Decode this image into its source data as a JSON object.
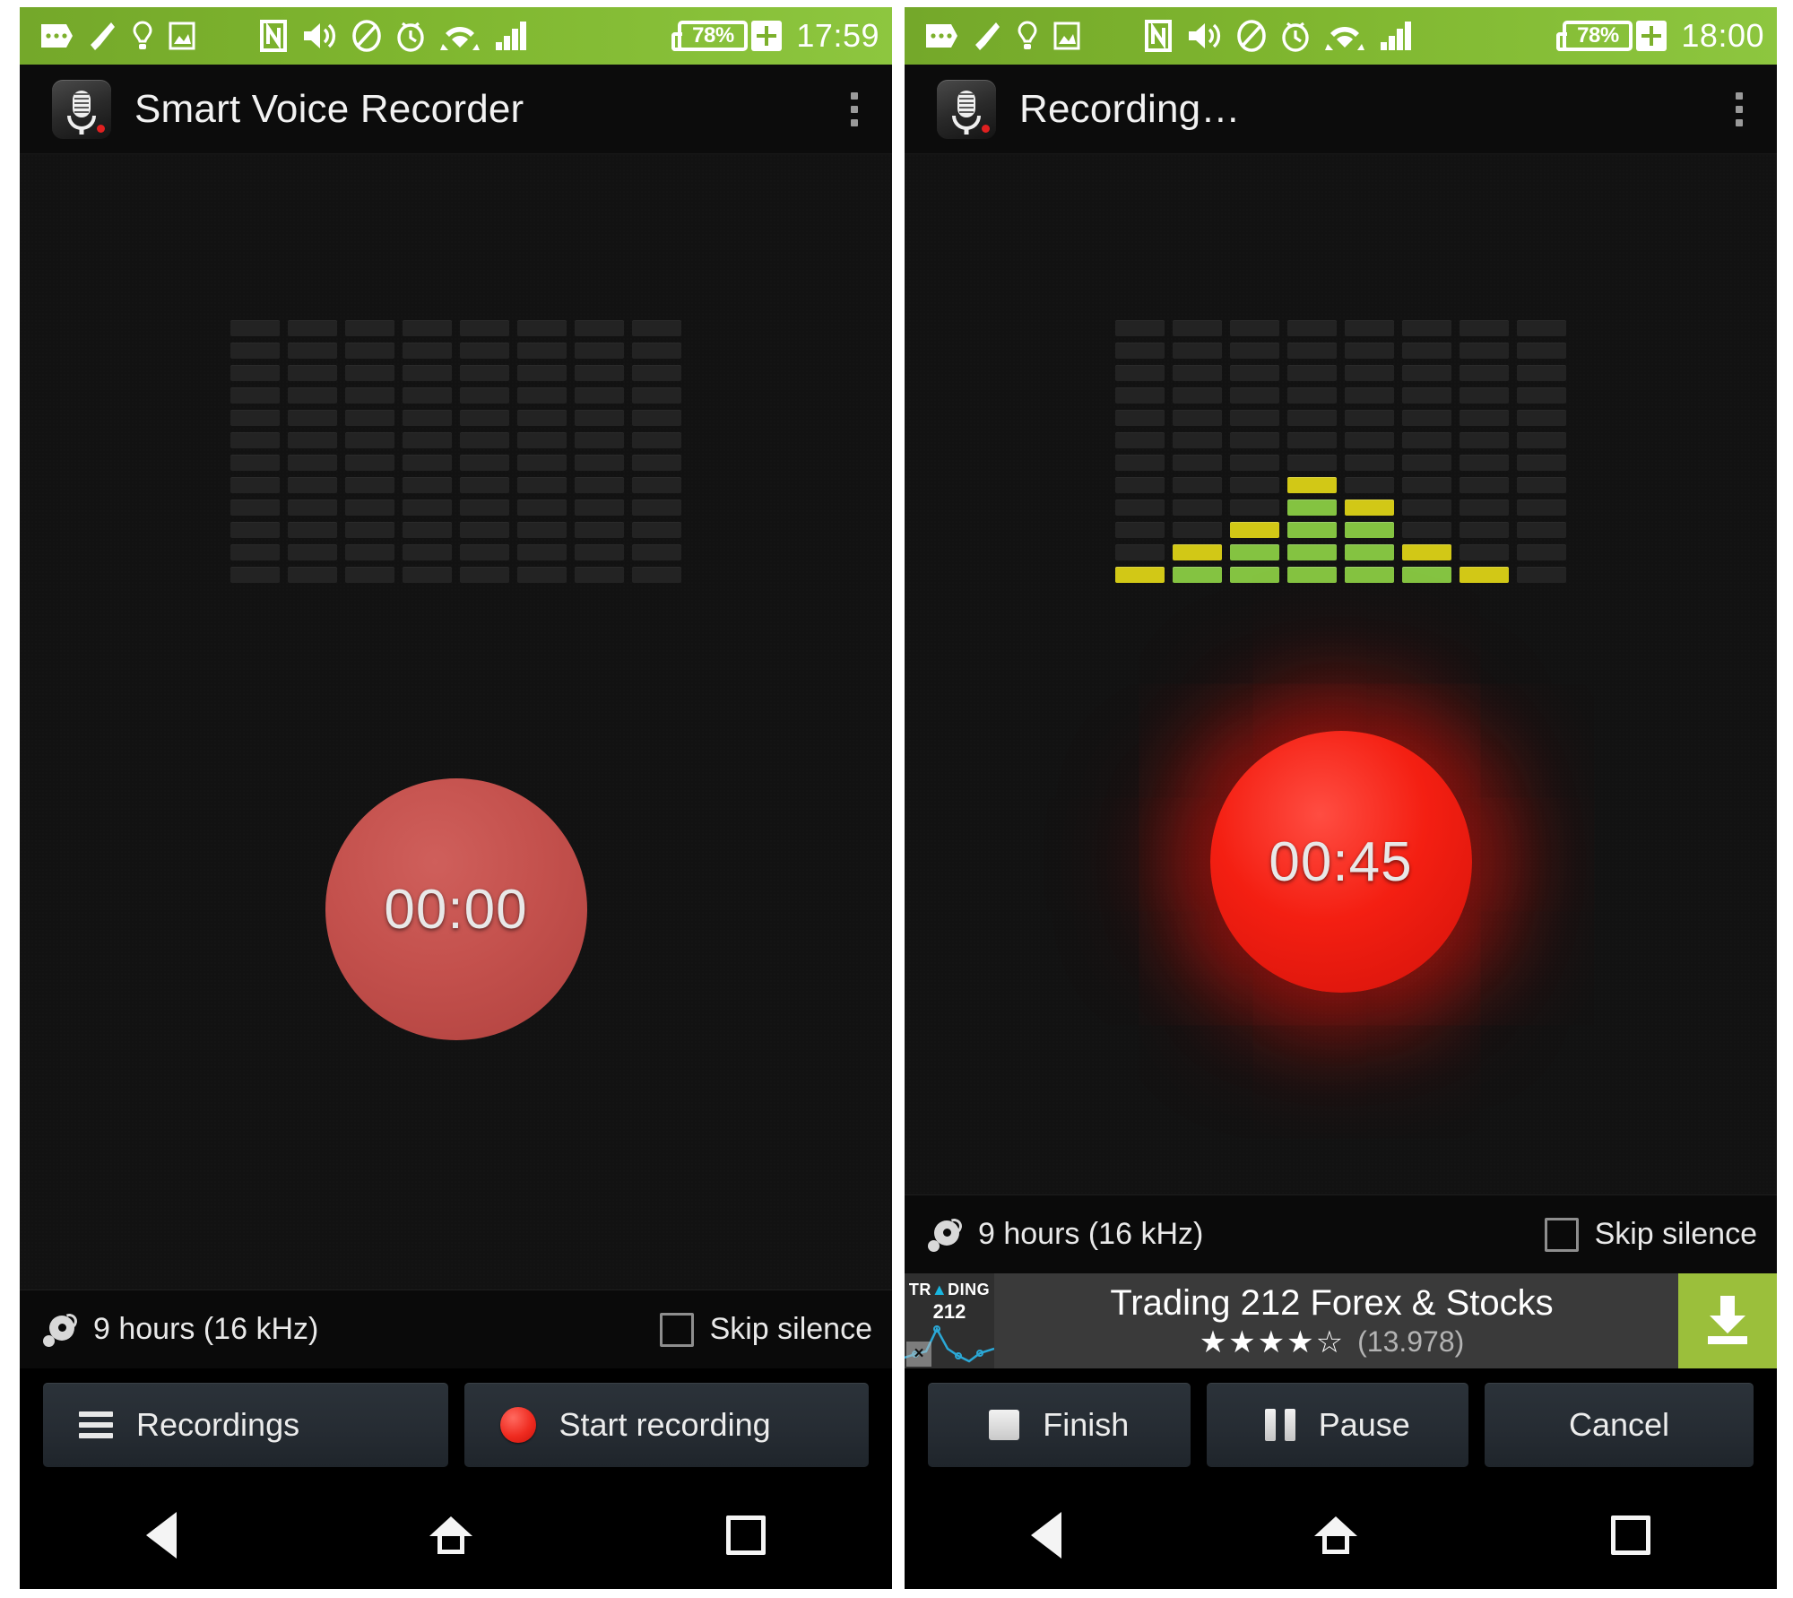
{
  "panels": [
    {
      "id": "idle",
      "statusbar": {
        "battery_pct": "78%",
        "time": "17:59",
        "icons": [
          "messages-icon",
          "phone-call-icon",
          "lightbulb-icon",
          "screenshot-icon",
          "nfc-icon",
          "volume-icon",
          "do-not-disturb-icon",
          "alarm-icon",
          "wifi-icon",
          "cellular-signal-icon"
        ],
        "charging_symbol": "+"
      },
      "titlebar": {
        "app_icon": "microphone-app-icon",
        "title": "Smart Voice Recorder",
        "overflow": "overflow-menu-icon"
      },
      "timer": "00:00",
      "info": {
        "icon": "disc-capacity-icon",
        "text": "9 hours (16 kHz)",
        "skip_silence_label": "Skip silence",
        "skip_silence_checked": false
      },
      "ad": null,
      "actions": [
        {
          "name": "recordings-button",
          "icon": "list-icon",
          "label": "Recordings"
        },
        {
          "name": "start-recording-button",
          "icon": "record-dot-icon",
          "label": "Start recording"
        }
      ],
      "nav": [
        "back-button",
        "home-button",
        "recents-button"
      ]
    },
    {
      "id": "recording",
      "statusbar": {
        "battery_pct": "78%",
        "time": "18:00",
        "icons": [
          "messages-icon",
          "phone-call-icon",
          "lightbulb-icon",
          "screenshot-icon",
          "nfc-icon",
          "volume-icon",
          "do-not-disturb-icon",
          "alarm-icon",
          "wifi-icon",
          "cellular-signal-icon"
        ],
        "charging_symbol": "+"
      },
      "titlebar": {
        "app_icon": "microphone-app-icon",
        "title": "Recording…",
        "overflow": "overflow-menu-icon"
      },
      "timer": "00:45",
      "info": {
        "icon": "disc-capacity-icon",
        "text": "9 hours (16 kHz)",
        "skip_silence_label": "Skip silence",
        "skip_silence_checked": false
      },
      "ad": {
        "logo_top": "TR",
        "logo_caret": "▲",
        "logo_top_end": "DING",
        "logo_number": "212",
        "title": "Trading 212 Forex & Stocks",
        "stars_filled": 4,
        "stars_total": 5,
        "rating_count": "(13.978)",
        "cta_icon": "download-icon",
        "close_label": "×"
      },
      "actions": [
        {
          "name": "finish-button",
          "icon": "stop-icon",
          "label": "Finish"
        },
        {
          "name": "pause-button",
          "icon": "pause-icon",
          "label": "Pause"
        },
        {
          "name": "cancel-button",
          "icon": null,
          "label": "Cancel"
        }
      ],
      "nav": [
        "back-button",
        "home-button",
        "recents-button"
      ]
    }
  ],
  "colors": {
    "statusbar_green": "#8dc63f",
    "eq_green": "#84c341",
    "eq_yellow": "#d2c816",
    "record_red_active": "#f41f12",
    "record_red_idle": "#c4514d",
    "ad_cta_green": "#9bbf3b",
    "body_bg": "#121212"
  },
  "chart_data": {
    "type": "bar",
    "title": "Audio level equalizer (8 bands, 12 segments)",
    "categories": [
      "1",
      "2",
      "3",
      "4",
      "5",
      "6",
      "7",
      "8"
    ],
    "segments_total": 12,
    "idle_values": [
      0,
      0,
      0,
      0,
      0,
      0,
      0,
      0
    ],
    "recording_values": [
      1,
      2,
      3,
      5,
      4,
      2,
      1,
      0
    ],
    "segment_colors": {
      "low": "#84c341",
      "peak": "#d2c816",
      "off": "#232323"
    },
    "xlabel": "",
    "ylabel": ""
  }
}
